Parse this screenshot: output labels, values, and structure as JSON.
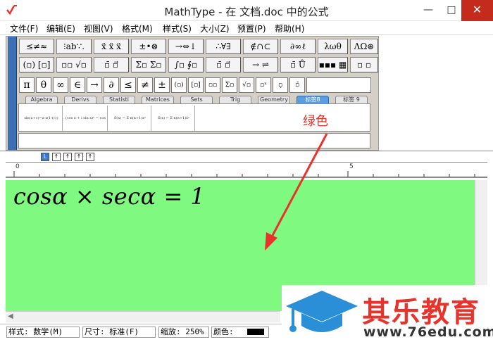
{
  "titlebar": {
    "title": "MathType - 在 文档.doc 中的公式",
    "minimize": "—",
    "maximize": "□",
    "close": "✕"
  },
  "menubar": {
    "items": [
      "文件(F)",
      "编辑(E)",
      "视图(V)",
      "格式(M)",
      "样式(S)",
      "大小(Z)",
      "预置(P)",
      "帮助(H)"
    ]
  },
  "toolbar": {
    "row1": [
      "≤≠≈",
      "⁝ab∵.",
      "ẍ ẍ ẍ",
      "±•⊗",
      "→⇔↓",
      "∴∀∃",
      "∉∩⊂",
      "∂∞ℓ",
      "λωθ",
      "ΛΩ⊛"
    ],
    "row2": [
      "(▫) [▫]",
      "▫▫ √▫",
      "▫̄ ▫⃗",
      "Σ▫ Σ▫",
      "∫▫ ∮▫",
      "▫̄ ▫⃗",
      "→ ⇌",
      "▫̄ Ů",
      "▪▪▪ ▦",
      "▫ ▫"
    ],
    "row3": [
      "π",
      "θ",
      "∞",
      "∈",
      "→",
      "∂",
      "≤",
      "≠",
      "±",
      "(▫)",
      "[▫]",
      "▫▫",
      "Σ▫",
      "√▫",
      "▫ˣ",
      "▫̣",
      "▫̄"
    ],
    "tabs": [
      "Algebra",
      "Derivs",
      "Statisti",
      "Matrices",
      "Sets",
      "Trig",
      "Geometry",
      "标签8",
      "标签 9"
    ],
    "active_tab": "标签8",
    "templates": [
      "sin(a+c)=a·x(1-(c))",
      "(cos x + i sin x)ⁿ = cos",
      "S(x) = Σ n(n+1)xⁿ",
      "S(x) = Σ n(n+1)xⁿ"
    ]
  },
  "style_bar": {
    "buttons": [
      "L",
      "↑",
      "↑",
      "↑",
      "↑"
    ]
  },
  "ruler": {
    "labels": [
      "0",
      "5"
    ]
  },
  "editor": {
    "equation": "cosα × secα = 1",
    "background_color": "#80f980"
  },
  "annotation": {
    "label": "绿色",
    "color": "#e8322b"
  },
  "statusbar": {
    "style": "样式: 数学(M)",
    "size": "尺寸: 标准(F)",
    "zoom": "缩放: 250%",
    "color_label": "颜色:",
    "current_color": "#000000"
  },
  "watermark": {
    "brand": "其乐教育",
    "url": "www.76edu.com"
  }
}
